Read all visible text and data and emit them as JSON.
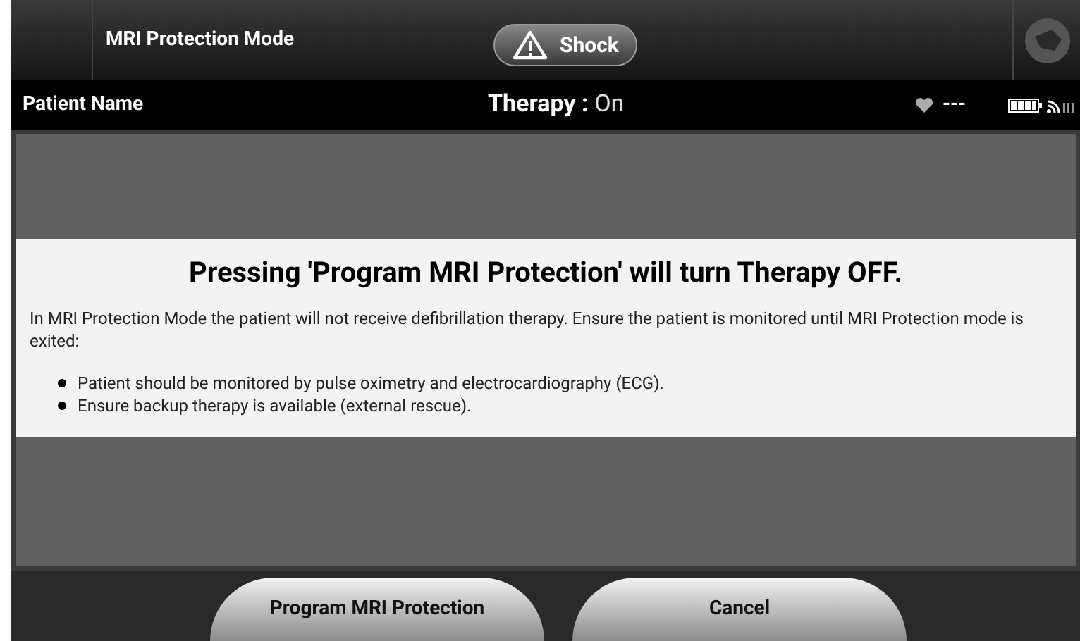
{
  "header": {
    "title": "MRI Protection Mode",
    "shock_button": "Shock"
  },
  "status_bar": {
    "patient": "Patient Name",
    "therapy_label": "Therapy :",
    "therapy_value": "On",
    "heart_rate": "---"
  },
  "dialog": {
    "heading": "Pressing 'Program MRI Protection' will turn Therapy OFF.",
    "body": "In MRI Protection Mode the patient will not receive defibrillation therapy. Ensure the patient is monitored until MRI Protection mode is exited:",
    "bullets": [
      "Patient should be monitored by pulse oximetry and electrocardiography (ECG).",
      "Ensure backup therapy is available (external rescue)."
    ]
  },
  "buttons": [
    "Program MRI Protection",
    "Cancel"
  ]
}
